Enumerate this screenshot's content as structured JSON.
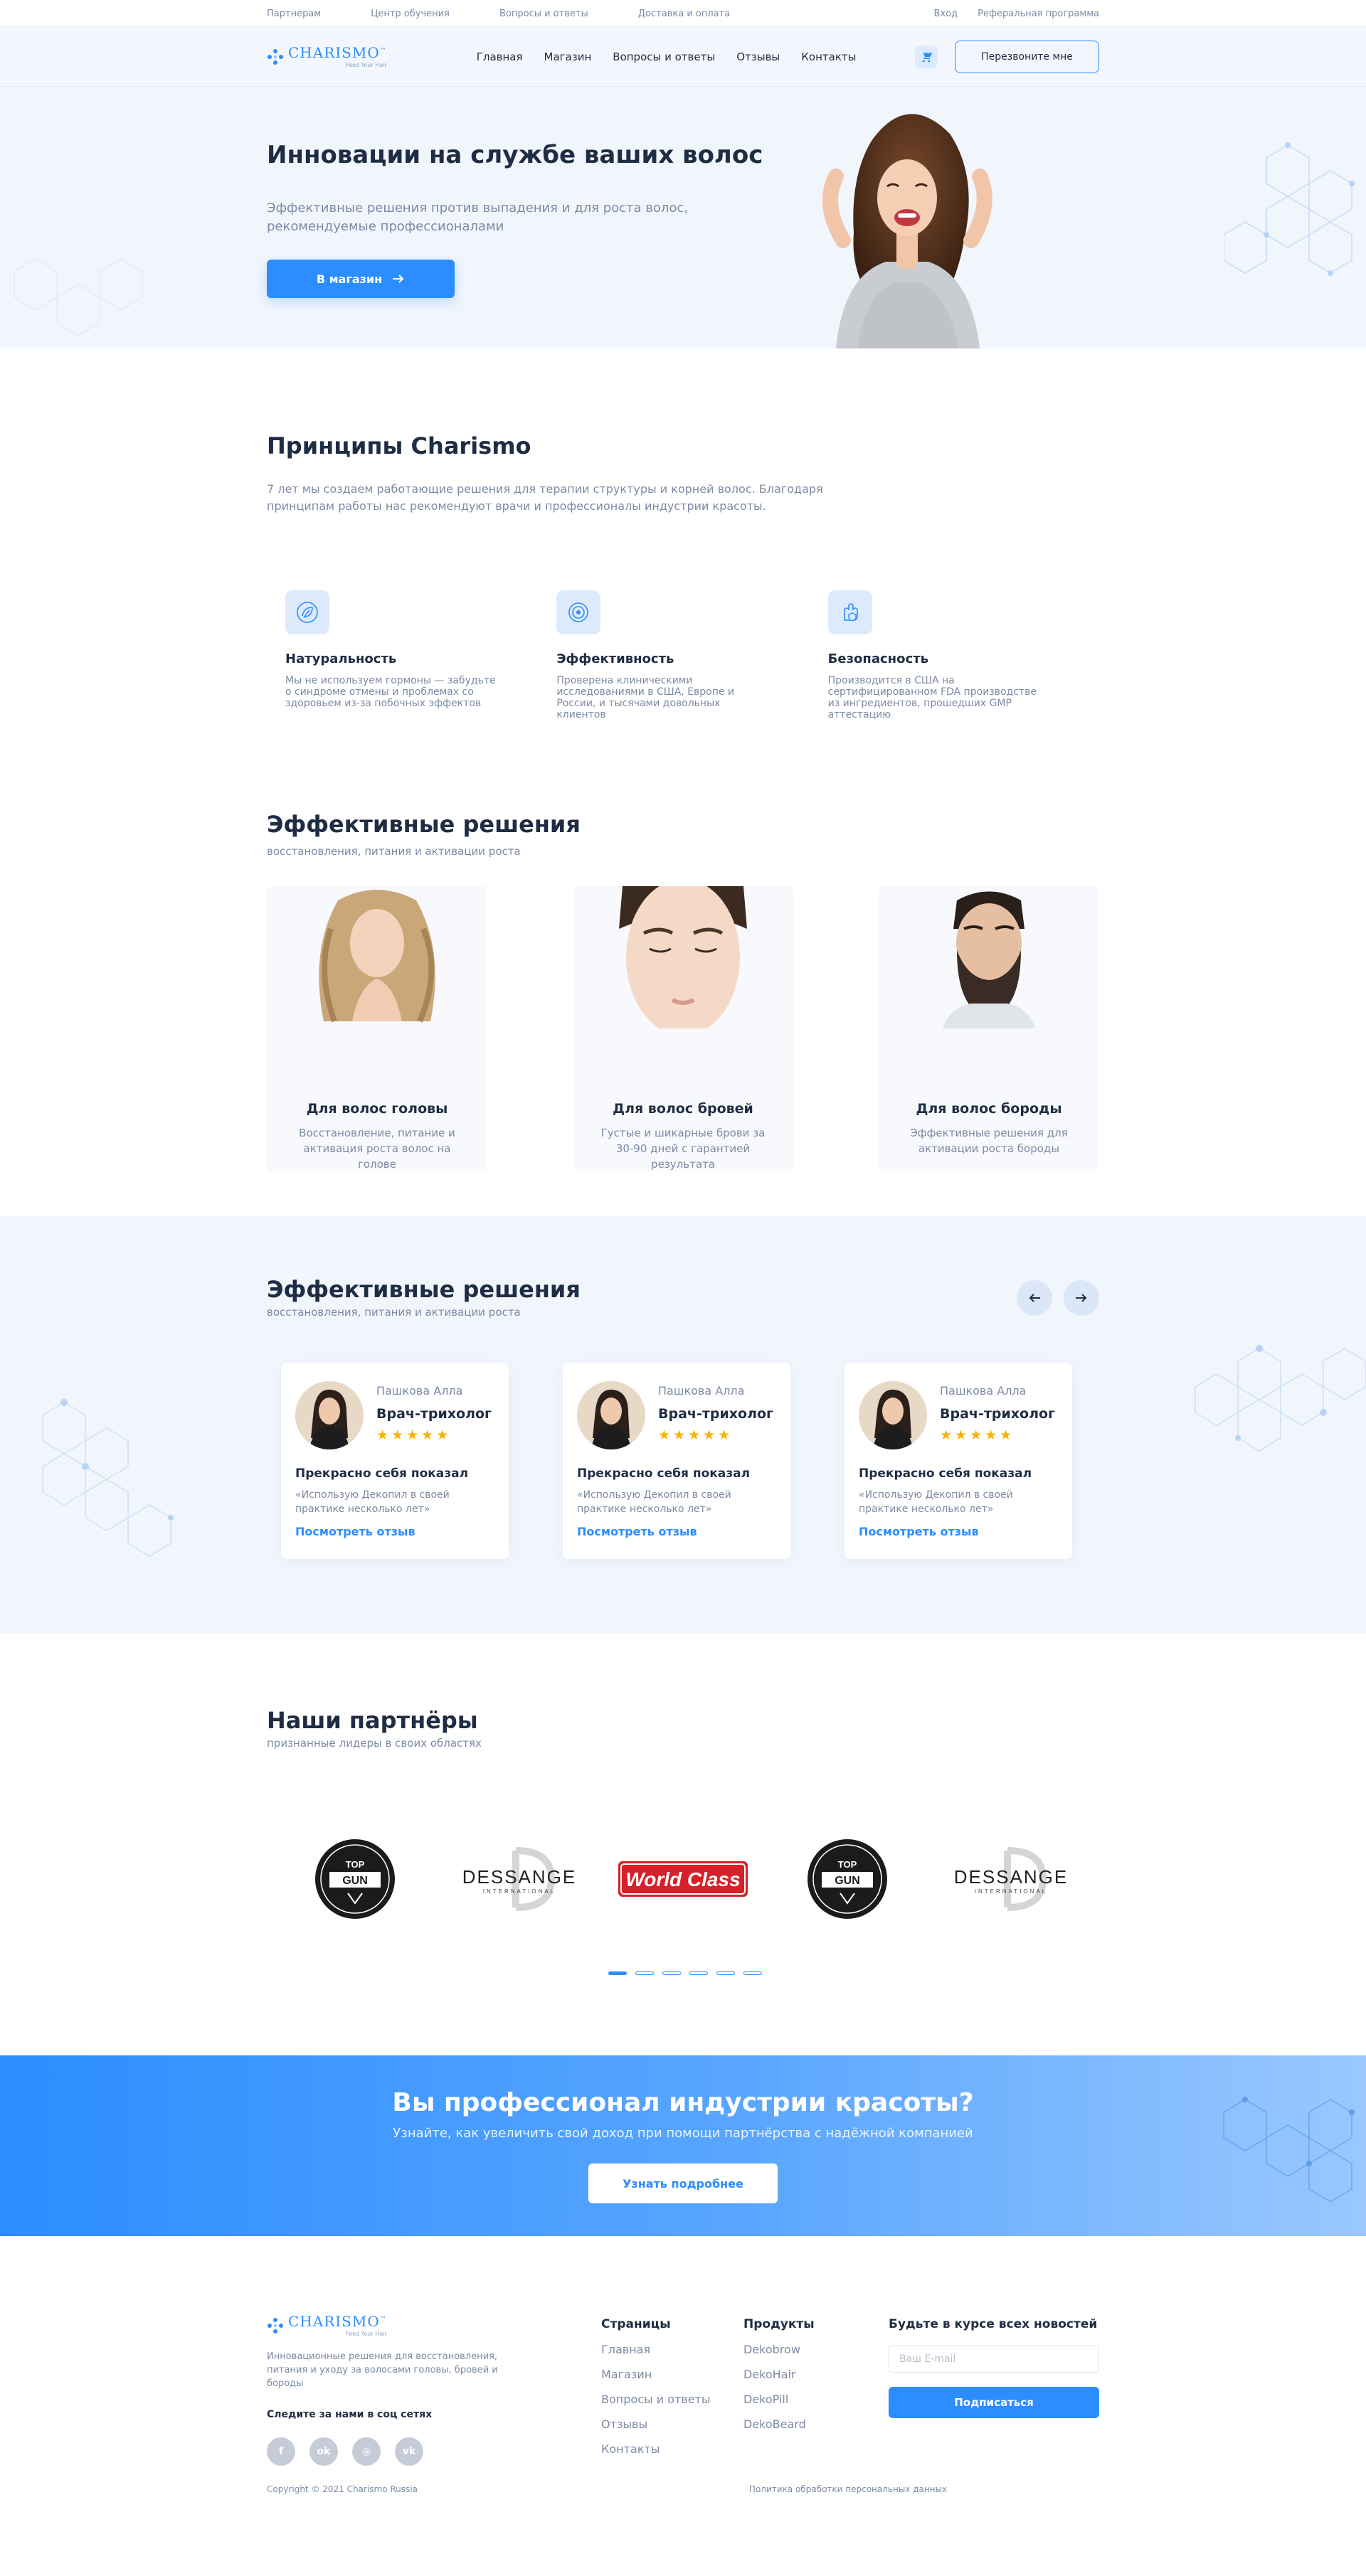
{
  "topbar": {
    "links": [
      "Партнерам",
      "Центр обучения",
      "Вопросы и ответы",
      "Доставка и оплата"
    ],
    "login": "Вход",
    "referral": "Реферальная программа"
  },
  "header": {
    "logo_text": "CHARISMO",
    "logo_tm": "™",
    "logo_sub": "Feed Your Hair",
    "nav": [
      "Главная",
      "Магазин",
      "Вопросы и ответы",
      "Отзывы",
      "Контакты"
    ],
    "callback_label": "Перезвоните мне"
  },
  "hero": {
    "title": "Инновации на службе ваших волос",
    "subtitle": "Эффективные решения против выпадения и для роста волос, рекомендуемые профессионалами",
    "button": "В магазин"
  },
  "principles": {
    "title": "Принципы Charismo",
    "description": "7 лет мы создаем работающие решения для терапии структуры и корней волос. Благодаря принципам работы нас рекомендуют врачи и профессионалы индустрии красоты.",
    "items": [
      {
        "title": "Натуральность",
        "text": "Мы не используем гормоны — забудьте о синдроме отмены и проблемах со здоровьем из-за побочных эффектов",
        "icon": "leaf-icon"
      },
      {
        "title": "Эффективность",
        "text": "Проверена клиническими исследованиями в США, Европе и России, и тысячами довольных клиентов",
        "icon": "target-icon"
      },
      {
        "title": "Безопасность",
        "text": "Производится в США на сертифицированном FDA производстве из ингредиентов, прошедших GMP аттестацию",
        "icon": "hand-shield-icon"
      }
    ]
  },
  "solutions": {
    "title": "Эффективные решения",
    "subtitle": "восстановления, питания и активации роста",
    "cards": [
      {
        "title": "Для волос головы",
        "text": "Восстановление, питание и активация роста волос на голове"
      },
      {
        "title": "Для волос бровей",
        "text": "Густые и шикарные брови за 30-90 дней с гарантией результата"
      },
      {
        "title": "Для волос бороды",
        "text": "Эффективные решения для активации роста бороды"
      }
    ]
  },
  "reviews": {
    "title": "Эффективные решения",
    "subtitle": "восстановления, питания и активации роста",
    "items": [
      {
        "name": "Пашкова Алла",
        "role": "Врач-трихолог",
        "stars": "★★★★★",
        "title": "Прекрасно себя показал",
        "text": "«Использую Декопил в своей практике несколько лет»",
        "link": "Посмотреть отзыв"
      },
      {
        "name": "Пашкова Алла",
        "role": "Врач-трихолог",
        "stars": "★★★★★",
        "title": "Прекрасно себя показал",
        "text": "«Использую Декопил в своей практике несколько лет»",
        "link": "Посмотреть отзыв"
      },
      {
        "name": "Пашкова Алла",
        "role": "Врач-трихолог",
        "stars": "★★★★★",
        "title": "Прекрасно себя показал",
        "text": "«Использую Декопил в своей практике несколько лет»",
        "link": "Посмотреть отзыв"
      }
    ]
  },
  "partners": {
    "title": "Наши партнёры",
    "subtitle": "признанные лидеры в своих областях",
    "logos": [
      {
        "top": "TOP",
        "bottom": "GUN"
      },
      {
        "main": "DESSANGE",
        "sub": "INTERNATIONAL"
      },
      {
        "main": "World Class"
      },
      {
        "top": "TOP",
        "bottom": "GUN"
      },
      {
        "main": "DESSANGE",
        "sub": "INTERNATIONAL"
      }
    ],
    "dots": 6,
    "active_dot": 0
  },
  "cta": {
    "title": "Вы профессионал индустрии красоты?",
    "subtitle": "Узнайте, как увеличить свой доход при помощи партнёрства с надёжной компанией",
    "button": "Узнать подробнее"
  },
  "footer": {
    "description": "Инновационные решения для восстановления, питания и уходу за волосами головы, бровей и бороды",
    "social_title": "Следите за нами в соц сетях",
    "socials": [
      "f",
      "ok",
      "◎",
      "vk"
    ],
    "pages_title": "Страницы",
    "pages": [
      "Главная",
      "Магазин",
      "Вопросы и ответы",
      "Отзывы",
      "Контакты"
    ],
    "products_title": "Продукты",
    "products": [
      "Dekobrow",
      "DekoHair",
      "DekoPill",
      "DekoBeard"
    ],
    "news_title": "Будьте в курсе всех новостей",
    "email_placeholder": "Ваш E-mail",
    "subscribe": "Подписаться",
    "copyright": "Copyright © 2021 Charismo Russia",
    "privacy": "Политика обработки персональных данных"
  },
  "colors": {
    "accent": "#2b8dff",
    "text": "#1f2d44",
    "muted": "#7c8aa3",
    "bg_light": "#f1f6fd",
    "star": "#f5b301"
  }
}
